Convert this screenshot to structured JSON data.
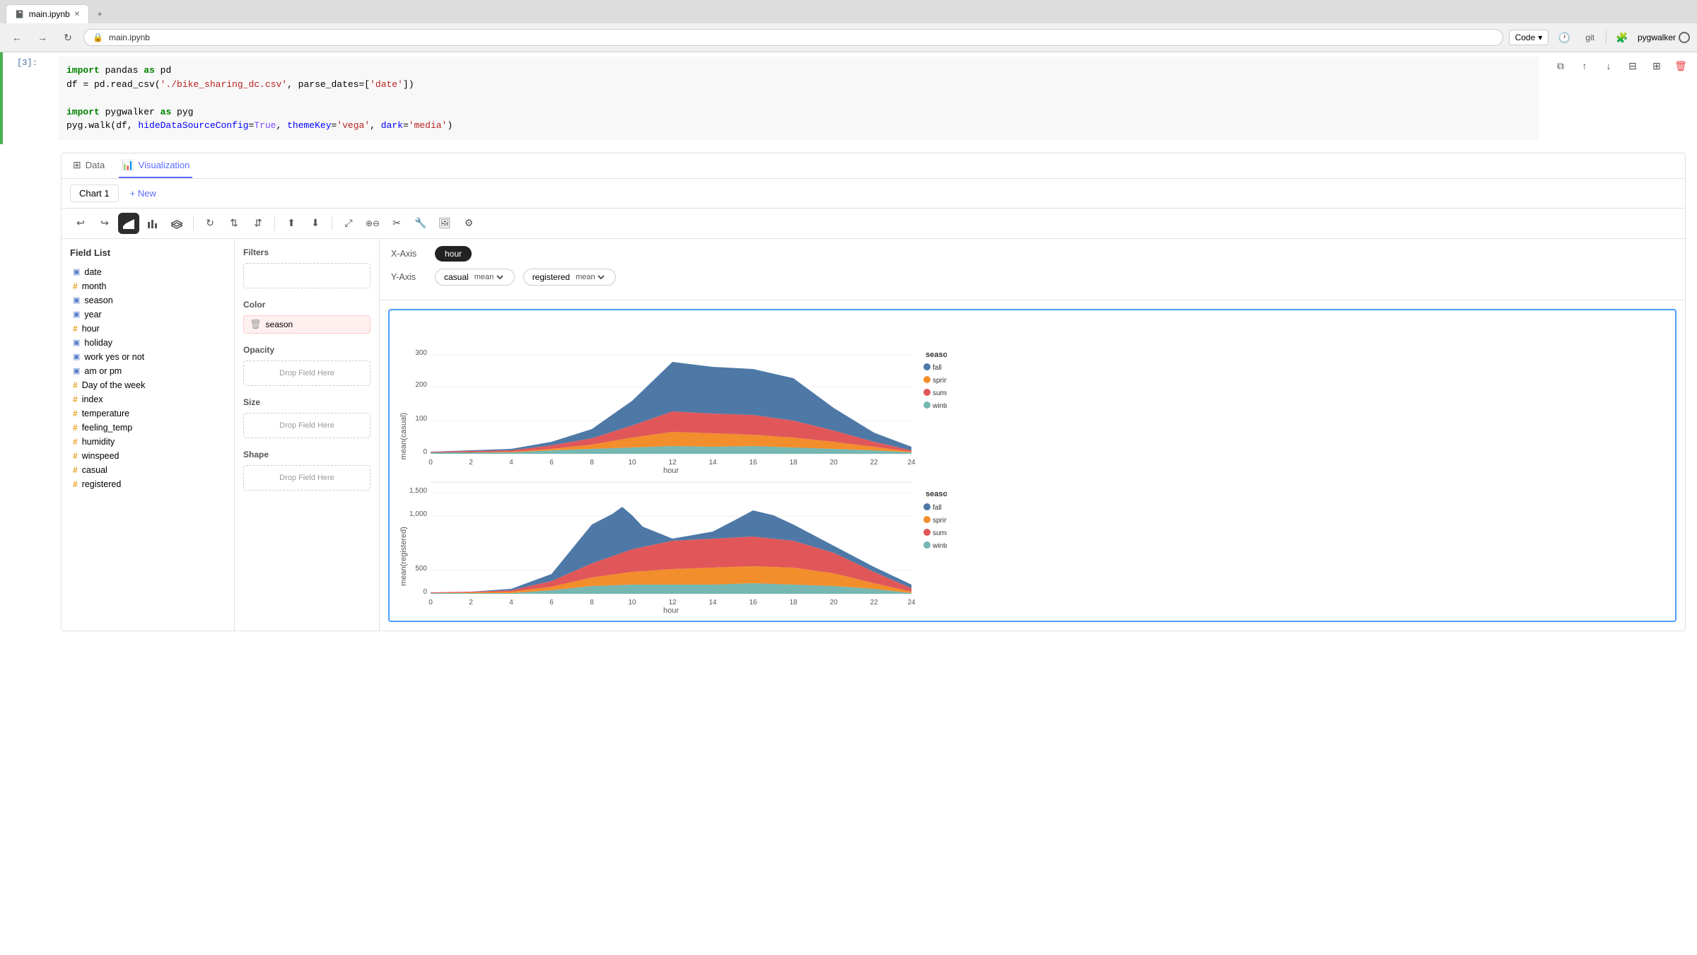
{
  "browser": {
    "tab_title": "main.ipynb",
    "nav_code_label": "Code",
    "nav_git_label": "git",
    "nav_extension": "pygwalker",
    "toolbar_right_label": "pygwalker"
  },
  "notebook": {
    "cell_number": "[3]:",
    "code_lines": [
      "import pandas as pd",
      "df = pd.read_csv('./bike_sharing_dc.csv', parse_dates=['date'])",
      "",
      "import pygwalker as pyg",
      "pyg.walk(df, hideDataSourceConfig=True, themeKey='vega', dark='media')"
    ]
  },
  "pygwalker": {
    "data_tab": "Data",
    "viz_tab": "Visualization",
    "chart_tab_1": "Chart 1",
    "chart_tab_new": "+ New",
    "x_axis_label": "X-Axis",
    "y_axis_label": "Y-Axis",
    "x_field": "hour",
    "y_fields": [
      {
        "name": "casual",
        "agg": "mean"
      },
      {
        "name": "registered",
        "agg": "mean"
      }
    ],
    "field_list_title": "Field List",
    "fields": [
      {
        "name": "date",
        "type": "cat"
      },
      {
        "name": "month",
        "type": "num"
      },
      {
        "name": "season",
        "type": "cat"
      },
      {
        "name": "year",
        "type": "cat"
      },
      {
        "name": "hour",
        "type": "num"
      },
      {
        "name": "holiday",
        "type": "cat"
      },
      {
        "name": "work yes or not",
        "type": "cat"
      },
      {
        "name": "am or pm",
        "type": "cat"
      },
      {
        "name": "Day of the week",
        "type": "num"
      },
      {
        "name": "index",
        "type": "num"
      },
      {
        "name": "temperature",
        "type": "num"
      },
      {
        "name": "feeling_temp",
        "type": "num"
      },
      {
        "name": "humidity",
        "type": "num"
      },
      {
        "name": "winspeed",
        "type": "num"
      },
      {
        "name": "casual",
        "type": "num"
      },
      {
        "name": "registered",
        "type": "num"
      }
    ],
    "filters_title": "Filters",
    "color_title": "Color",
    "color_field": "season",
    "opacity_title": "Opacity",
    "size_title": "Size",
    "shape_title": "Shape",
    "drop_zone_text": "Drop Field Here",
    "legend": {
      "title": "season",
      "items": [
        {
          "label": "fall",
          "color": "#4e79a7"
        },
        {
          "label": "spring",
          "color": "#f28e2b"
        },
        {
          "label": "summer",
          "color": "#e15759"
        },
        {
          "label": "winter",
          "color": "#76b7b2"
        }
      ]
    },
    "chart1": {
      "title": "mean(casual)",
      "x_label": "hour",
      "y_max": 300,
      "y_ticks": [
        0,
        100,
        200,
        300
      ]
    },
    "chart2": {
      "title": "mean(registered)",
      "x_label": "hour",
      "y_max": 1500,
      "y_ticks": [
        0,
        500,
        1000,
        1500
      ]
    }
  }
}
